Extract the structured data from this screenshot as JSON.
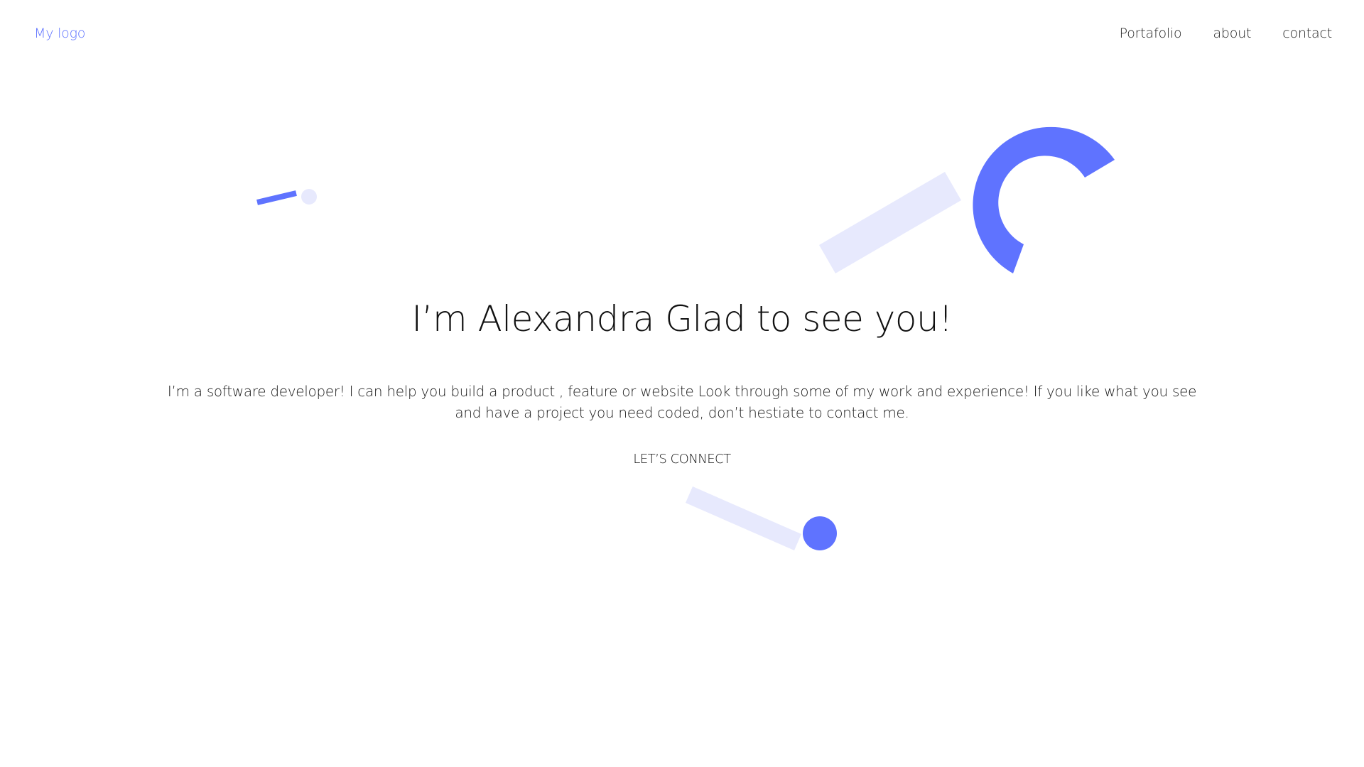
{
  "header": {
    "logo": "My logo",
    "nav": [
      "Portafolio",
      "about",
      "contact"
    ]
  },
  "hero": {
    "title": "I’m Alexandra Glad to see you!",
    "description": "I’m a software developer! I can help you build a product , feature or website Look through some of my work and experience! If you like what you see and have a project you need coded, don’t hestiate to contact me.",
    "cta_label": "LET’S CONNECT"
  },
  "colors": {
    "accent": "#5f73ff",
    "accent_light": "#e7e9fd",
    "text": "#111111"
  }
}
